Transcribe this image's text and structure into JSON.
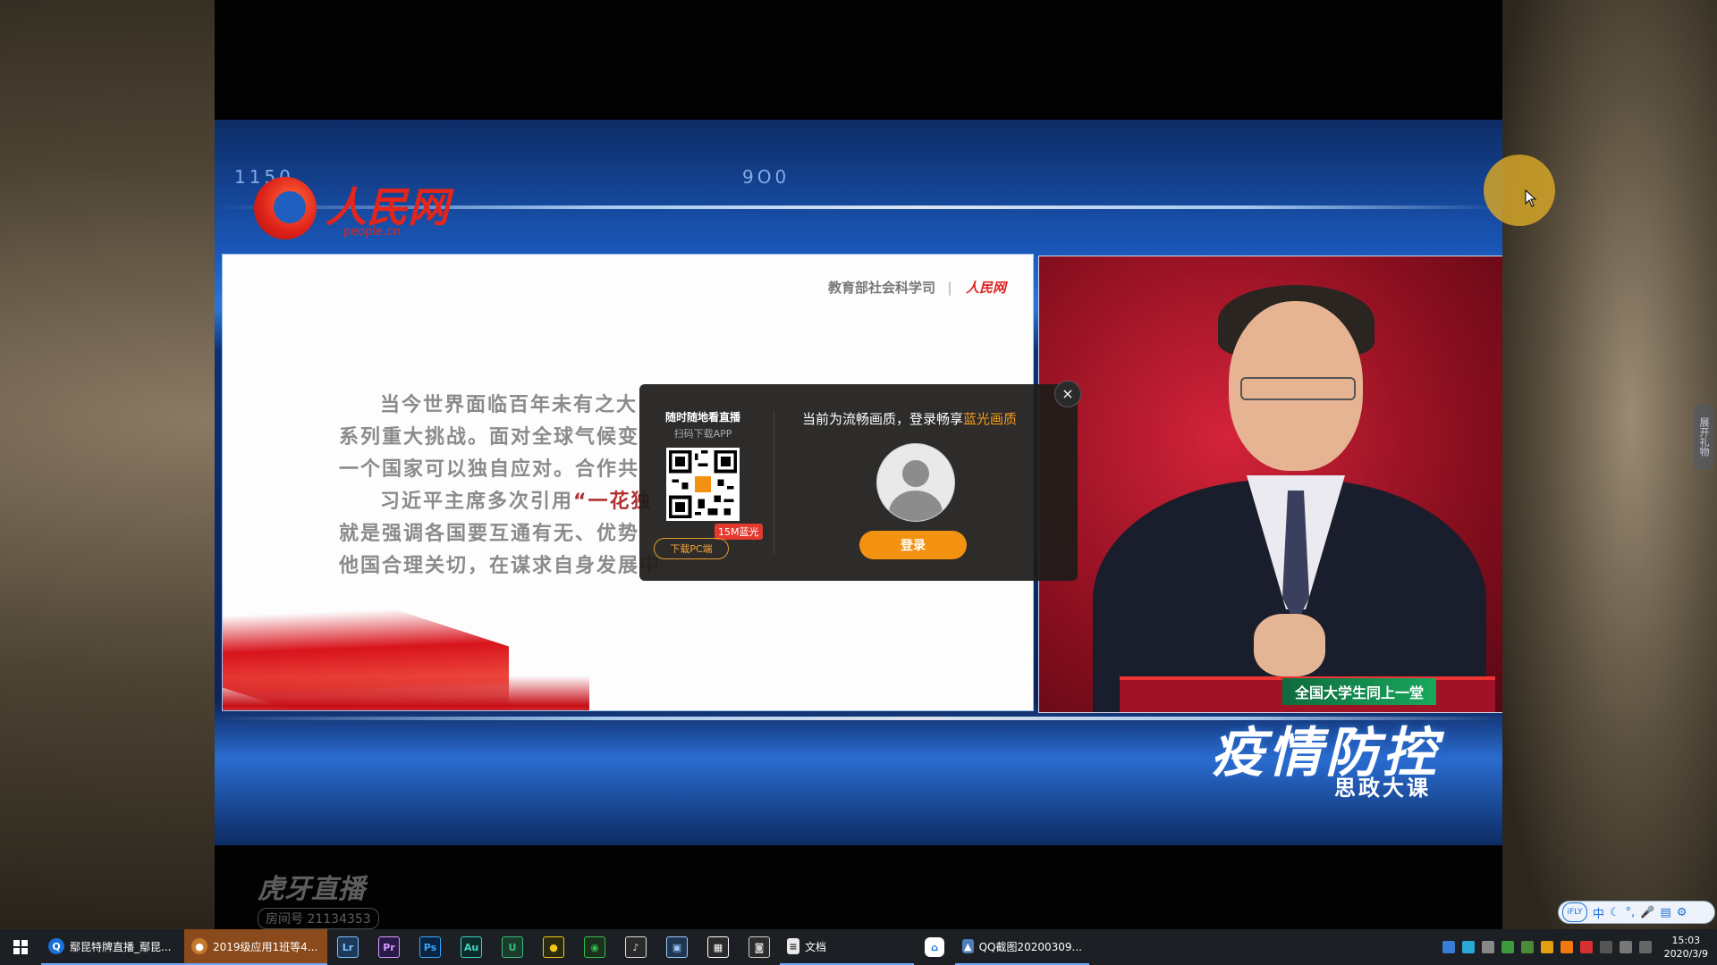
{
  "player": {
    "frame_code_left": "1150",
    "frame_code_mid": "9O0",
    "brand_logo_text": "人民网",
    "brand_logo_sub": "people.cn",
    "slide": {
      "header_org": "教育部社会科学司",
      "header_logo": "人民网",
      "lines": [
        {
          "text": "当今世界面临百年未有之大",
          "highlight": ""
        },
        {
          "text": "系列重大挑战。面对全球气候变",
          "highlight": ""
        },
        {
          "text": "一个国家可以独自应对。合作共",
          "highlight": ""
        },
        {
          "text": "习近平主席多次引用",
          "highlight": "“一花独"
        },
        {
          "text": "就是强调各国要互通有无、优势",
          "highlight": ""
        },
        {
          "text": "他国合理关切，在谋求自身发展中",
          "highlight": ""
        }
      ]
    },
    "speaker_tag": "全国大学生同上一堂",
    "program_title": "疫情防控",
    "program_subtitle": "思政大课",
    "watermark_brand": "虎牙直播",
    "watermark_room": "房间号 21134353"
  },
  "login_dialog": {
    "close_label": "×",
    "promo_title": "随时随地看直播",
    "promo_sub": "扫码下载APP",
    "badge": "15M蓝光",
    "download_pc": "下载PC端",
    "message_prefix": "当前为流畅画质，登录畅享",
    "message_highlight": "蓝光画质",
    "login_button": "登录"
  },
  "side_tab": "展开礼物",
  "ime": {
    "logo": "iFLY",
    "items": [
      "中",
      "☾",
      "°,",
      "🎤",
      "▤",
      "⚙"
    ]
  },
  "taskbar": {
    "tasks": [
      {
        "label": "鄢昆特牌直播_鄢昆...",
        "icon": "browser-icon"
      },
      {
        "label": "2019级应用1班等4...",
        "icon": "chat-avatar-icon"
      }
    ],
    "pinned": [
      {
        "name": "lightroom-icon",
        "glyph": "Lr",
        "color": "#1e3a5a",
        "fg": "#7ec0ff"
      },
      {
        "name": "premiere-icon",
        "glyph": "Pr",
        "color": "#2a1a4a",
        "fg": "#d59bff"
      },
      {
        "name": "photoshop-icon",
        "glyph": "Ps",
        "color": "#0a2340",
        "fg": "#31a8ff"
      },
      {
        "name": "audition-icon",
        "glyph": "Au",
        "color": "#0d2b2b",
        "fg": "#3fd6c0"
      },
      {
        "name": "app-u-icon",
        "glyph": "U",
        "color": "#1c3b2d",
        "fg": "#38c07a"
      },
      {
        "name": "colorful-app-icon",
        "glyph": "●",
        "color": "#2b2b10",
        "fg": "#f5c518"
      },
      {
        "name": "wechat-icon",
        "glyph": "◉",
        "color": "#1d2f1d",
        "fg": "#2ec24b"
      },
      {
        "name": "microphone-app-icon",
        "glyph": "♪",
        "color": "#2a2a2a",
        "fg": "#dddddd"
      },
      {
        "name": "window-app-icon",
        "glyph": "▣",
        "color": "#1f3550",
        "fg": "#9cc9ff"
      },
      {
        "name": "calculator-icon",
        "glyph": "▦",
        "color": "#2a2a2a",
        "fg": "#ffffff"
      },
      {
        "name": "camera-app-icon",
        "glyph": "◙",
        "color": "#2c2c2c",
        "fg": "#cccccc"
      }
    ],
    "doc_task": {
      "label": "文档",
      "icon": "document-icon"
    },
    "extra_icon": "network-app-icon",
    "screenshot_task": {
      "label": "QQ截图20200309...",
      "icon": "image-icon"
    },
    "clock_time": "15:03",
    "clock_date": "2020/3/9"
  }
}
